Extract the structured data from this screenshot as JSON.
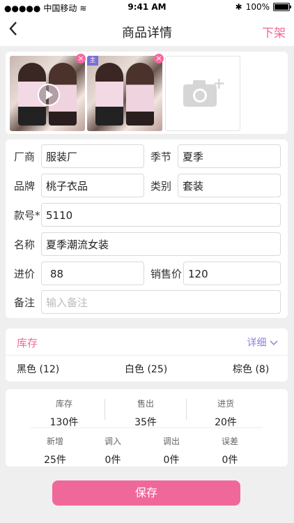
{
  "status_bar": {
    "carrier": "中国移动",
    "time": "9:41 AM",
    "battery": "100%"
  },
  "nav": {
    "title": "商品详情",
    "action": "下架"
  },
  "photos": {
    "main_tag": "主"
  },
  "form": {
    "manufacturer": {
      "label": "厂商",
      "value": "服装厂"
    },
    "season": {
      "label": "季节",
      "value": "夏季"
    },
    "brand": {
      "label": "品牌",
      "value": "桃子衣品"
    },
    "category": {
      "label": "类别",
      "value": "套装"
    },
    "style_no": {
      "label": "款号*",
      "value": "5110"
    },
    "name": {
      "label": "名称",
      "value": "夏季潮流女装"
    },
    "cost": {
      "label": "进价",
      "value": "88"
    },
    "price": {
      "label": "销售价",
      "value": "120"
    },
    "note": {
      "label": "备注",
      "placeholder": "输入备注"
    }
  },
  "stock": {
    "title": "库存",
    "detail": "详细",
    "colors": [
      "黑色 (12)",
      "白色 (25)",
      "棕色 (8)"
    ]
  },
  "summary": {
    "row1": [
      {
        "k": "库存",
        "v": "130件"
      },
      {
        "k": "售出",
        "v": "35件"
      },
      {
        "k": "进货",
        "v": "20件"
      }
    ],
    "row2": [
      {
        "k": "新增",
        "v": "25件"
      },
      {
        "k": "调入",
        "v": "0件"
      },
      {
        "k": "调出",
        "v": "0件"
      },
      {
        "k": "误差",
        "v": "0件"
      }
    ]
  },
  "save_label": "保存",
  "colors": {
    "accent": "#f0689a",
    "purple": "#8c7fd8"
  }
}
